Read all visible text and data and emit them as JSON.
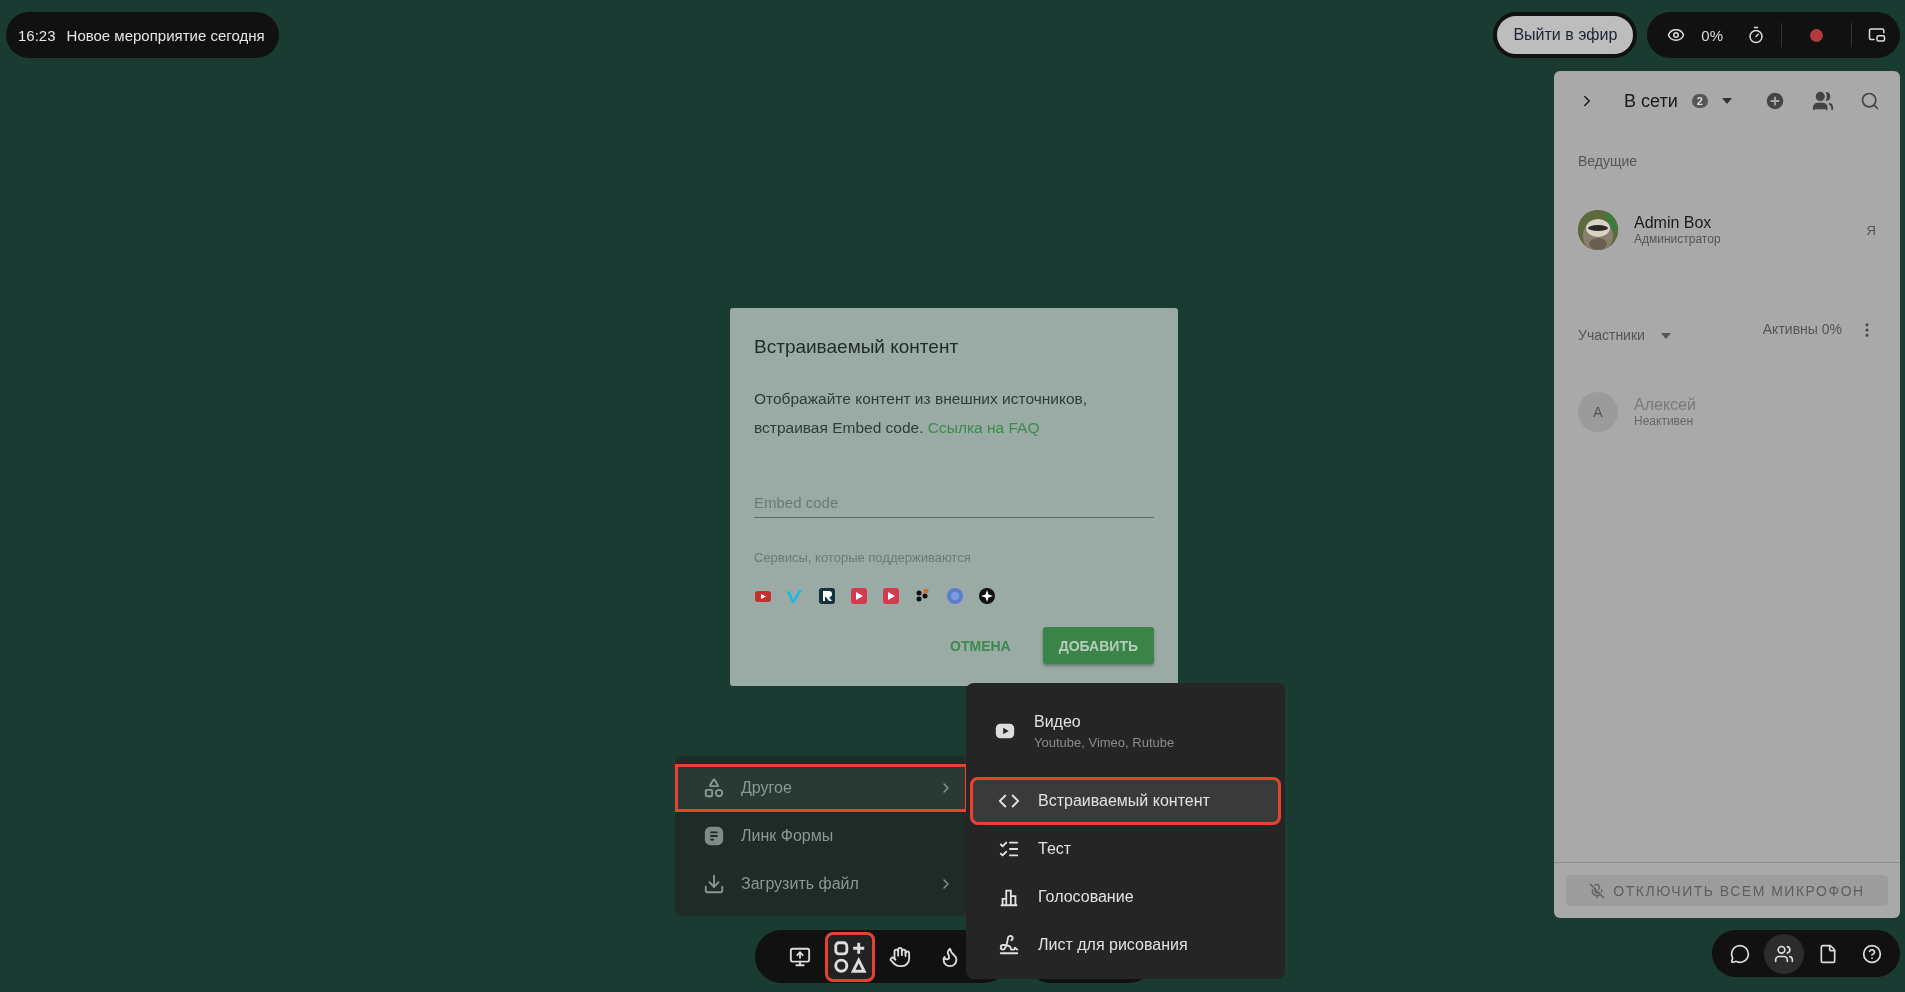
{
  "event_bar": {
    "time": "16:23",
    "title": "Новое мероприятие сегодня"
  },
  "go_live_button": {
    "label": "Выйти в эфир"
  },
  "stream_status": {
    "viewers": "0%",
    "recording": true
  },
  "panel": {
    "title": "В сети",
    "count": "2",
    "hosts_heading": "Ведущие",
    "hosts": [
      {
        "name": "Admin Box",
        "role": "Администратор",
        "tag": "Я"
      }
    ],
    "members_heading": "Участники",
    "activity": "Активны 0%",
    "members": [
      {
        "name": "Алексей",
        "status": "Неактивен",
        "initial": "А",
        "active": false
      }
    ],
    "mute_all_button": {
      "label": "ОТКЛЮЧИТЬ ВСЕМ МИКРОФОН",
      "disabled": true
    }
  },
  "side_toolbar": [
    {
      "selected": false
    },
    {
      "selected": true
    },
    {
      "selected": false
    },
    {
      "selected": false
    }
  ],
  "dialog": {
    "title": "Встраиваемый контент",
    "text": "Отображайте контент из внешних источников, встраивая Embed code.",
    "link": "Ссылка на FAQ",
    "field": {
      "placeholder": "Embed code"
    },
    "services_label": "Сервисы, которые поддерживаются",
    "buttons": [
      {
        "label": "ОТМЕНА",
        "kind": "text"
      },
      {
        "label": "ДОБАВИТЬ",
        "kind": "filled"
      }
    ]
  },
  "menu": [
    {
      "label": "Другое",
      "submenu": true,
      "selected": true,
      "outlined": true
    },
    {
      "label": "Линк Формы",
      "submenu": false,
      "selected": false,
      "outlined": false
    },
    {
      "label": "Загрузить файл",
      "submenu": true,
      "selected": false,
      "outlined": false
    }
  ],
  "submenu": [
    {
      "label": "Видео",
      "subtitle": "Youtube, Vimeo, Rutube",
      "selected": false,
      "outlined": false
    },
    {
      "label": "Встраиваемый контент",
      "selected": true,
      "outlined": true
    },
    {
      "label": "Тест",
      "selected": false,
      "outlined": false
    },
    {
      "label": "Голосование",
      "selected": false,
      "outlined": false
    },
    {
      "label": "Лист для рисования",
      "selected": false,
      "outlined": false
    }
  ],
  "toolbar": [
    {
      "selected": false,
      "outlined": false
    },
    {
      "selected": true,
      "outlined": true
    },
    {
      "selected": false,
      "outlined": false
    },
    {
      "selected": false,
      "outlined": false
    }
  ]
}
